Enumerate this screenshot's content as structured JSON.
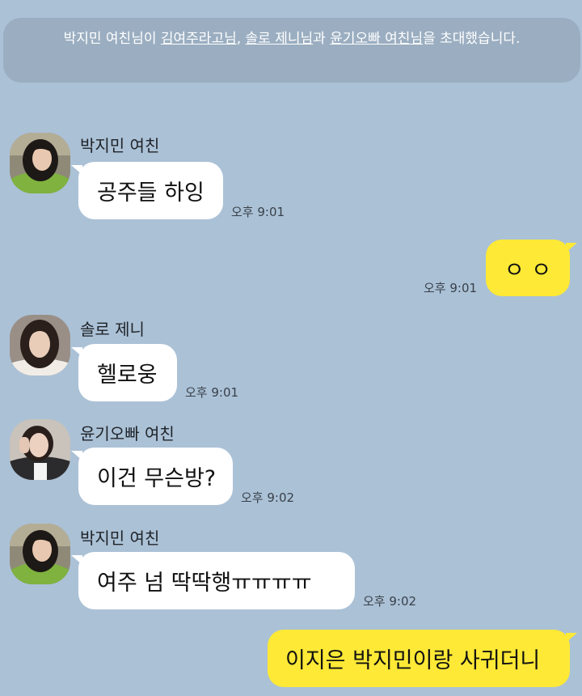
{
  "system_notice": {
    "text_before": "박지민 여친님이 ",
    "invitee_1": "김여주라고님",
    "sep_1": ", ",
    "invitee_2": "솔로 제니님",
    "sep_2": "과 ",
    "invitee_3": "윤기오빠 여친님",
    "text_after": "을 초대했습니다."
  },
  "messages": [
    {
      "sender": "박지민 여친",
      "text": "공주들 하잉",
      "time": "오후 9:01",
      "avatar": "person-photo-park"
    },
    {
      "text": "ㅇ ㅇ",
      "time": "오후 9:01"
    },
    {
      "sender": "솔로 제니",
      "text": "헬로웅",
      "time": "오후 9:01",
      "avatar": "person-photo-jennie"
    },
    {
      "sender": "윤기오빠 여친",
      "text": "이건 무슨방?",
      "time": "오후 9:02",
      "avatar": "person-photo-yoongi-gf"
    },
    {
      "sender": "박지민 여친",
      "text": "여주 넘 딱딱행ㅠㅠㅠㅠ",
      "time": "오후 9:02",
      "avatar": "person-photo-park"
    },
    {
      "text": "이지은 박지민이랑 사귀더니"
    }
  ],
  "colors": {
    "background": "#abc1d6",
    "notice_background": "#9baec1",
    "incoming_bubble": "#ffffff",
    "outgoing_bubble": "#fde936"
  }
}
